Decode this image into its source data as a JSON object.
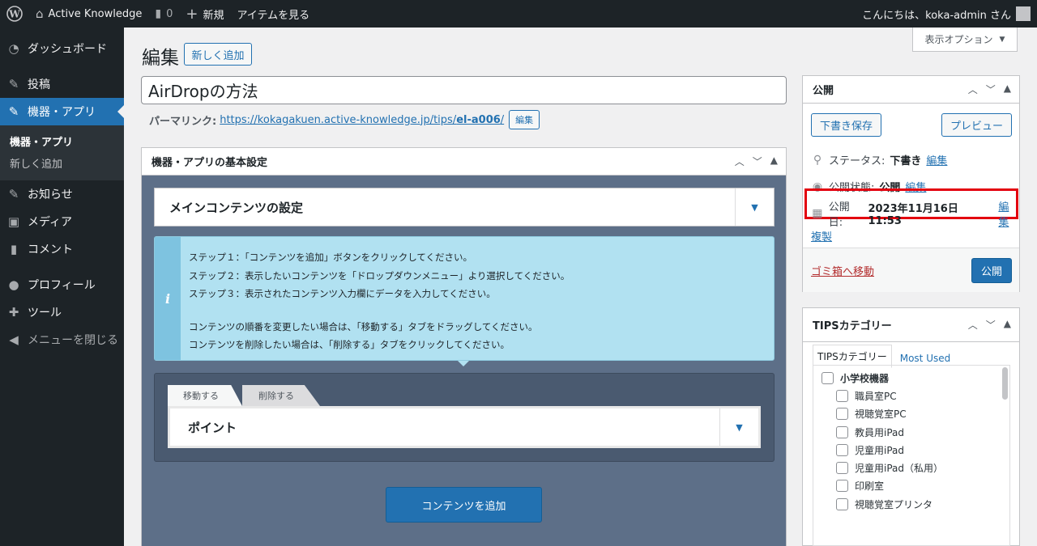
{
  "adminbar": {
    "site_name": "Active Knowledge",
    "comment_count": "0",
    "new_label": "新規",
    "view_label": "アイテムを見る",
    "greeting": "こんにちは、koka-admin さん"
  },
  "sidebar": {
    "items": [
      {
        "label": "ダッシュボード"
      },
      {
        "label": "投稿"
      },
      {
        "label": "機器・アプリ"
      },
      {
        "label": "お知らせ"
      },
      {
        "label": "メディア"
      },
      {
        "label": "コメント"
      },
      {
        "label": "プロフィール"
      },
      {
        "label": "ツール"
      },
      {
        "label": "メニューを閉じる"
      }
    ],
    "submenu": [
      "機器・アプリ",
      "新しく追加"
    ]
  },
  "header": {
    "screen_options": "表示オプション",
    "title": "編集",
    "add_new": "新しく追加"
  },
  "post": {
    "title_value": "AirDropの方法",
    "permalink_label": "パーマリンク:",
    "permalink_base": "https://kokagakuen.active-knowledge.jp/tips/",
    "permalink_slug": "el-a006",
    "permalink_end": "/",
    "edit_button": "編集"
  },
  "acf": {
    "box_title": "機器・アプリの基本設定",
    "main_settings": "メインコンテンツの設定",
    "info_lines": [
      "ステップ１：「コンテンツを追加」ボタンをクリックしてください。",
      "ステップ２：表示したいコンテンツを「ドロップダウンメニュー」より選択してください。",
      "ステップ３：表示されたコンテンツ入力欄にデータを入力してください。",
      "",
      "コンテンツの順番を変更したい場合は、「移動する」タブをドラッグしてください。",
      "コンテンツを削除したい場合は、「削除する」タブをクリックしてください。"
    ],
    "tab_move": "移動する",
    "tab_delete": "削除する",
    "point_label": "ポイント",
    "add_content": "コンテンツを追加"
  },
  "publish": {
    "title": "公開",
    "save_draft": "下書き保存",
    "preview": "プレビュー",
    "status_label": "ステータス:",
    "status_value": "下書き",
    "visibility_label": "公開状態:",
    "visibility_value": "公開",
    "date_label": "公開日:",
    "date_value": "2023年11月16日 11:53",
    "edit_link": "編集",
    "duplicate": "複製",
    "trash": "ゴミ箱へ移動",
    "publish_button": "公開"
  },
  "tips": {
    "title": "TIPSカテゴリー",
    "tab_all": "TIPSカテゴリー",
    "tab_most_used": "Most Used",
    "categories": [
      {
        "label": "小学校機器",
        "level": 0
      },
      {
        "label": "職員室PC",
        "level": 1
      },
      {
        "label": "視聴覚室PC",
        "level": 1
      },
      {
        "label": "教員用iPad",
        "level": 1
      },
      {
        "label": "児童用iPad",
        "level": 1
      },
      {
        "label": "児童用iPad（私用）",
        "level": 1
      },
      {
        "label": "印刷室",
        "level": 1
      },
      {
        "label": "視聴覚室プリンタ",
        "level": 1
      }
    ]
  }
}
